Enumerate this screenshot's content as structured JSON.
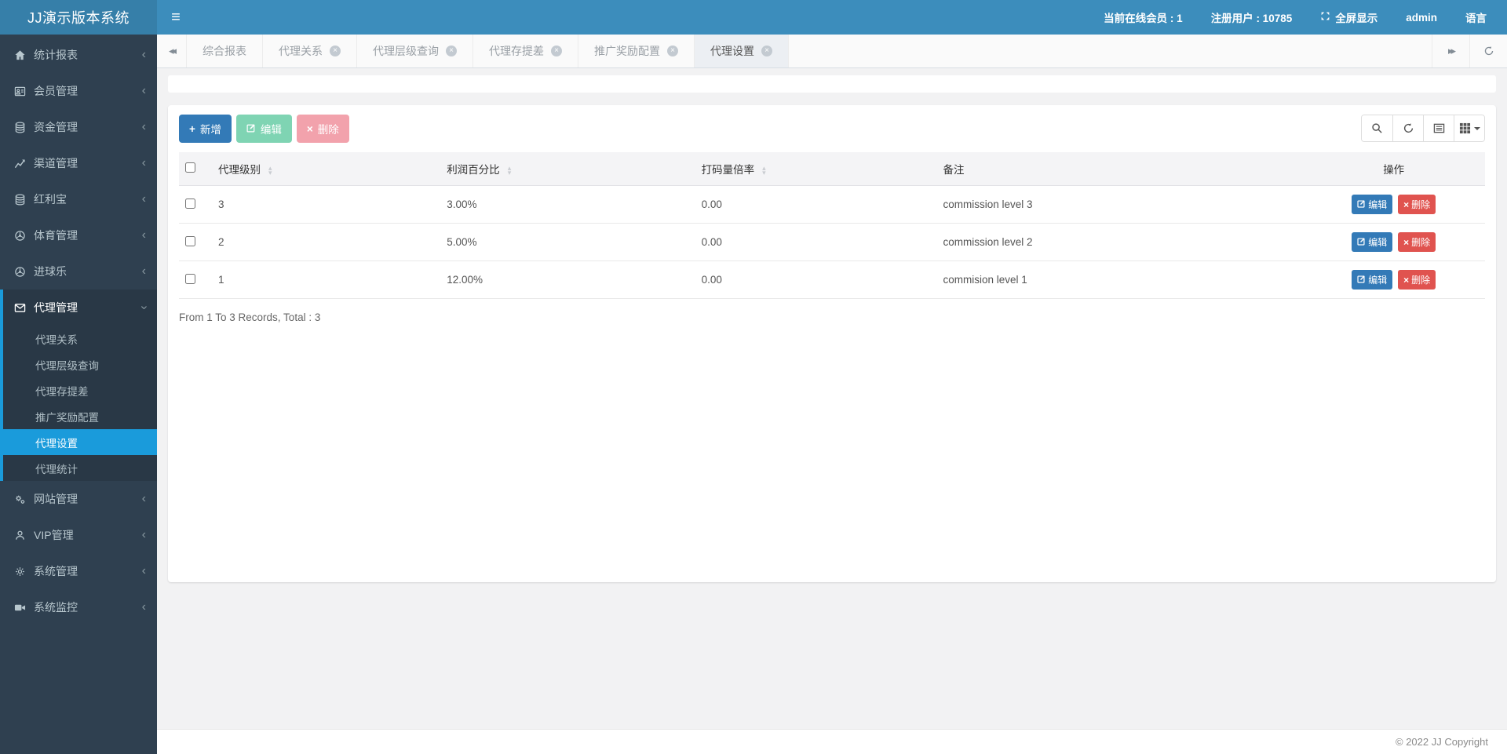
{
  "header": {
    "logo": "JJ演示版本系统",
    "online": "当前在线会员 : 1",
    "registered": "注册用户 : 10785",
    "fullscreen": "全屏显示",
    "username": "admin",
    "language": "语言"
  },
  "sidebar": {
    "items": [
      {
        "label": "统计报表",
        "icon": "home"
      },
      {
        "label": "会员管理",
        "icon": "member-card"
      },
      {
        "label": "资金管理",
        "icon": "database"
      },
      {
        "label": "渠道管理",
        "icon": "chart-line"
      },
      {
        "label": "红利宝",
        "icon": "database"
      },
      {
        "label": "体育管理",
        "icon": "futbol"
      },
      {
        "label": "进球乐",
        "icon": "futbol"
      },
      {
        "label": "代理管理",
        "icon": "envelope",
        "expanded": true
      },
      {
        "label": "网站管理",
        "icon": "gears"
      },
      {
        "label": "VIP管理",
        "icon": "user"
      },
      {
        "label": "系统管理",
        "icon": "gear"
      },
      {
        "label": "系统监控",
        "icon": "video-camera"
      }
    ],
    "agent_submenu": [
      {
        "label": "代理关系"
      },
      {
        "label": "代理层级查询"
      },
      {
        "label": "代理存提差"
      },
      {
        "label": "推广奖励配置"
      },
      {
        "label": "代理设置",
        "active": true
      },
      {
        "label": "代理统计"
      }
    ]
  },
  "tabs": [
    {
      "label": "综合报表",
      "closable": false
    },
    {
      "label": "代理关系",
      "closable": true
    },
    {
      "label": "代理层级查询",
      "closable": true
    },
    {
      "label": "代理存提差",
      "closable": true
    },
    {
      "label": "推广奖励配置",
      "closable": true
    },
    {
      "label": "代理设置",
      "closable": true,
      "active": true
    }
  ],
  "toolbar": {
    "add": "新增",
    "edit": "编辑",
    "delete": "删除",
    "icon_buttons": [
      "search-icon",
      "refresh-icon",
      "detail-view-icon",
      "columns-icon"
    ]
  },
  "table": {
    "columns": [
      "代理级别",
      "利润百分比",
      "打码量倍率",
      "备注",
      "操作"
    ],
    "rows": [
      {
        "level": "3",
        "profit": "3.00%",
        "bet_multiple": "0.00",
        "remark": "commission level 3"
      },
      {
        "level": "2",
        "profit": "5.00%",
        "bet_multiple": "0.00",
        "remark": "commission level 2"
      },
      {
        "level": "1",
        "profit": "12.00%",
        "bet_multiple": "0.00",
        "remark": "commision level 1"
      }
    ],
    "row_actions": {
      "edit": "编辑",
      "delete": "删除"
    }
  },
  "pagination": {
    "summary": "From 1 To 3 Records, Total : 3"
  },
  "footer": {
    "copyright": "© 2022 JJ Copyright"
  },
  "glyphs": {
    "hamburger": "≡",
    "chevron_left": "‹",
    "tabs_left": "◂◂",
    "tabs_right": "▸▸",
    "sort_up": "▴",
    "sort_down": "▾",
    "plus": "+",
    "close": "×"
  },
  "colors": {
    "navbar": "#3c8dbc",
    "logo_bg": "#367fa9",
    "sidebar": "#2f4050",
    "active_blue": "#1a9bdb",
    "primary": "#337ab7",
    "danger": "#e0534f"
  }
}
